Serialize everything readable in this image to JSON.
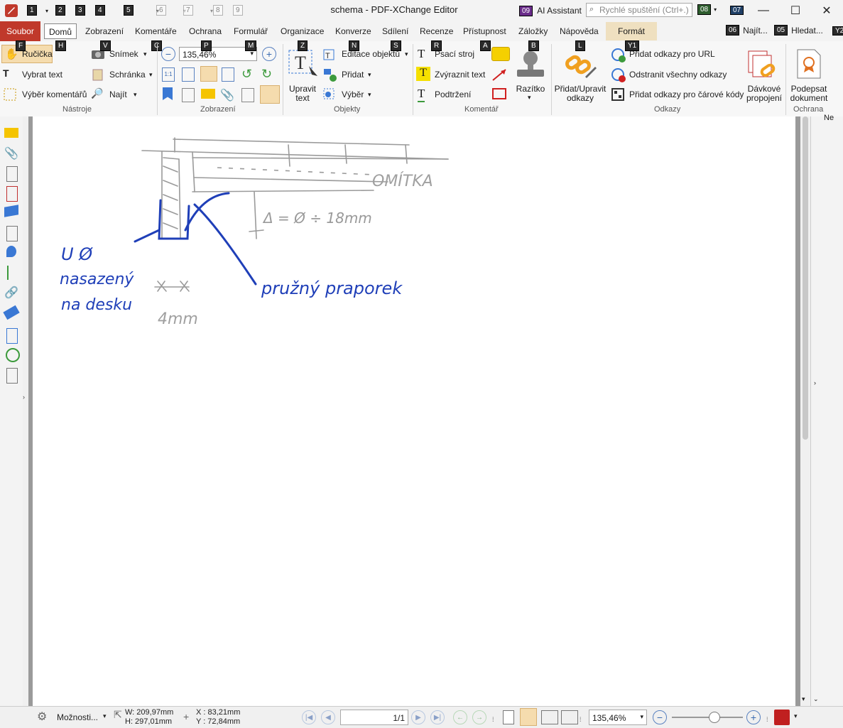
{
  "app": {
    "window_title": "schema - PDF-XChange Editor",
    "ai_assistant": "AI Assistant",
    "quick_launch_placeholder": "Rychlé spuštění (Ctrl+.)",
    "keytips_title": {
      "k1": "1",
      "k2": "2",
      "k3": "3",
      "k4": "4",
      "k5": "5",
      "k6": "6",
      "k7": "7",
      "k8": "8",
      "k9": "9",
      "ai": "09",
      "ql": "08",
      "k07": "07"
    }
  },
  "menu": {
    "file": "Soubor",
    "items": [
      "Domů",
      "Zobrazení",
      "Komentáře",
      "Ochrana",
      "Formulář",
      "Organizace",
      "Konverze",
      "Sdílení",
      "Recenze",
      "Přístupnost",
      "Záložky",
      "Nápověda",
      "Formát"
    ],
    "right_find": "Najít...",
    "right_search": "Hledat...",
    "right_find_tip": "06",
    "right_search_tip": "05",
    "right_extra": "Y2"
  },
  "ribbon": {
    "tools": {
      "label": "Nástroje",
      "hand": "Ručička",
      "select_text": "Vybrat text",
      "select_comments": "Výběr komentářů",
      "snapshot": "Snímek",
      "clipboard": "Schránka",
      "find": "Najít",
      "tips": {
        "hand": "F",
        "snapshot": "V",
        "clipboard": "C",
        "select_text": "H"
      }
    },
    "view": {
      "label": "Zobrazení",
      "zoom": "135,46%",
      "tips": {
        "p": "P",
        "m": "M"
      }
    },
    "objects": {
      "label": "Objekty",
      "edit_text": "Upravit text",
      "edit_objects": "Editace objektů",
      "add": "Přidat",
      "select": "Výběr",
      "tips": {
        "z": "Z",
        "n": "N",
        "s": "S"
      }
    },
    "comment": {
      "label": "Komentář",
      "typewriter": "Psací stroj",
      "highlight": "Zvýraznit text",
      "underline": "Podtržení",
      "stamp": "Razítko",
      "tips": {
        "r": "R",
        "a": "A",
        "b": "B"
      }
    },
    "links": {
      "label": "Odkazy",
      "add_edit": "Přidat/Upravit odkazy",
      "add_url": "Přidat odkazy pro URL",
      "remove_all": "Odstranit všechny odkazy",
      "add_barcode": "Přidat odkazy pro čárové kódy",
      "batch": "Dávkové propojení",
      "tips": {
        "l": "L",
        "y1": "Y1"
      }
    },
    "protect": {
      "label": "Ochrana",
      "sign": "Podepsat dokument"
    }
  },
  "document": {
    "annotations": {
      "omitka": "OMÍTKA",
      "delta": "Δ = Ø ÷ 18mm",
      "left_note_1": "U Ø",
      "left_note_2": "nasazený",
      "left_note_3": "na desku",
      "profile": "pružný praporek",
      "gap": "4mm"
    },
    "right_panel_text": "Ne"
  },
  "statusbar": {
    "options": "Možnosti...",
    "width": "W: 209,97mm",
    "height": "H: 297,01mm",
    "x": "X : 83,21mm",
    "y": "Y : 72,84mm",
    "page": "1/1",
    "zoom": "135,46%",
    "zoom_slider_value": 0.6
  }
}
